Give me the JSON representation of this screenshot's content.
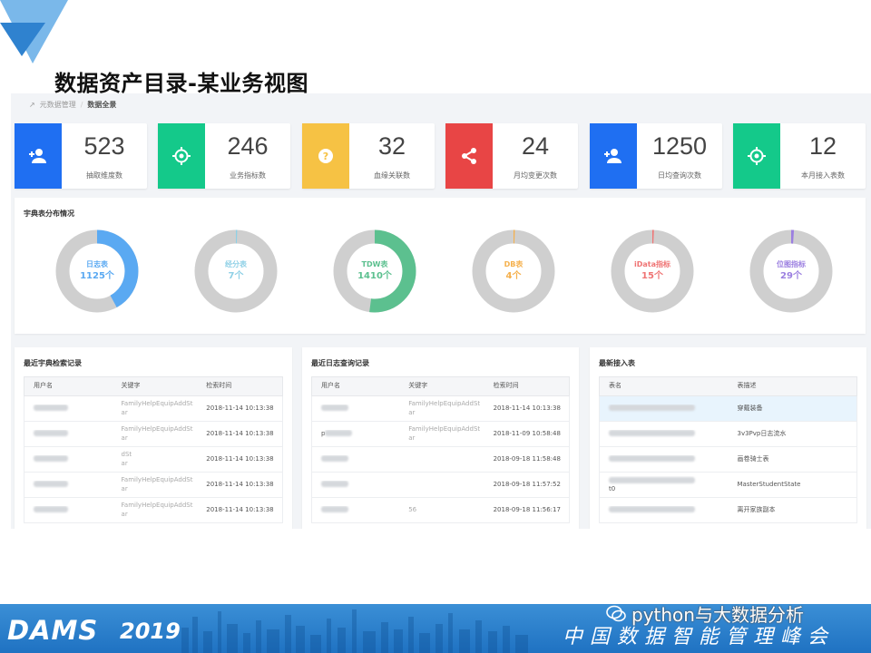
{
  "title": "数据资产目录-某业务视图",
  "breadcrumb": {
    "parent": "元数据管理",
    "sep": "/",
    "current": "数据全景"
  },
  "stats": [
    {
      "value": "523",
      "label": "抽取维度数",
      "color": "#1f6ff2",
      "icon": "user-add-icon"
    },
    {
      "value": "246",
      "label": "业务指标数",
      "color": "#14c98a",
      "icon": "target-icon"
    },
    {
      "value": "32",
      "label": "血缘关联数",
      "color": "#f6c244",
      "icon": "question-icon"
    },
    {
      "value": "24",
      "label": "月均变更次数",
      "color": "#e84545",
      "icon": "share-icon"
    },
    {
      "value": "1250",
      "label": "日均查询次数",
      "color": "#1f6ff2",
      "icon": "user-add-icon"
    },
    {
      "value": "12",
      "label": "本月接入表数",
      "color": "#14c98a",
      "icon": "target-icon"
    }
  ],
  "donut_panel": {
    "title": "宇典表分布情况",
    "items": [
      {
        "name": "日志表",
        "value": "1125个",
        "fraction": 0.42,
        "color": "#5aa9f2"
      },
      {
        "name": "经分表",
        "value": "7个",
        "fraction": 0.004,
        "color": "#8ed0e6"
      },
      {
        "name": "TDW表",
        "value": "1410个",
        "fraction": 0.52,
        "color": "#5cc08f"
      },
      {
        "name": "DB表",
        "value": "4个",
        "fraction": 0.003,
        "color": "#f5b04c"
      },
      {
        "name": "iData指标",
        "value": "15个",
        "fraction": 0.006,
        "color": "#ef7474"
      },
      {
        "name": "位图指标",
        "value": "29个",
        "fraction": 0.011,
        "color": "#9b7fe0"
      }
    ],
    "track_color": "#cfcfcf"
  },
  "panel_search": {
    "title": "最近宇典检索记录",
    "headers": [
      "用户名",
      "关键字",
      "检索时间"
    ],
    "rows": [
      {
        "kw1": "FamilyHelpEquipAddSt",
        "kw2": "ar",
        "time": "2018-11-14 10:13:38"
      },
      {
        "kw1": "FamilyHelpEquipAddSt",
        "kw2": "ar",
        "time": "2018-11-14 10:13:38"
      },
      {
        "kw1": "dSt",
        "kw2": "ar",
        "time": "2018-11-14 10:13:38"
      },
      {
        "kw1": "FamilyHelpEquipAddSt",
        "kw2": "ar",
        "time": "2018-11-14 10:13:38"
      },
      {
        "kw1": "FamilyHelpEquipAddSt",
        "kw2": "ar",
        "time": "2018-11-14 10:13:38"
      }
    ]
  },
  "panel_log": {
    "title": "最近日志查询记录",
    "headers": [
      "用户名",
      "关键字",
      "检索时间"
    ],
    "rows": [
      {
        "user": "",
        "kw1": "FamilyHelpEquipAddSt",
        "kw2": "ar",
        "time": "2018-11-14 10:13:38"
      },
      {
        "user": "p",
        "kw1": "FamilyHelpEquipAddSt",
        "kw2": "ar",
        "time": "2018-11-09 10:58:48"
      },
      {
        "user": "",
        "kw1": "",
        "kw2": "",
        "time": "2018-09-18 11:58:48"
      },
      {
        "user": "",
        "kw1": "",
        "kw2": "",
        "time": "2018-09-18 11:57:52"
      },
      {
        "user": "",
        "kw1": "56",
        "kw2": "",
        "time": "2018-09-18 11:56:17"
      }
    ]
  },
  "panel_new": {
    "title": "最新接入表",
    "headers": [
      "表名",
      "表描述"
    ],
    "rows": [
      {
        "name_tail": "",
        "desc": "穿戴装备"
      },
      {
        "name_tail": "",
        "desc": "3v3Pvp日志流水"
      },
      {
        "name_tail": "",
        "desc": "画卷骑士表"
      },
      {
        "name_tail": "t0",
        "desc": "MasterStudentState"
      },
      {
        "name_tail": "",
        "desc": "离开家族副本"
      }
    ]
  },
  "footer": {
    "logo": "DAMS",
    "year": "2019",
    "summit": "中国数据智能管理峰会",
    "watermark": "python与大数据分析"
  }
}
